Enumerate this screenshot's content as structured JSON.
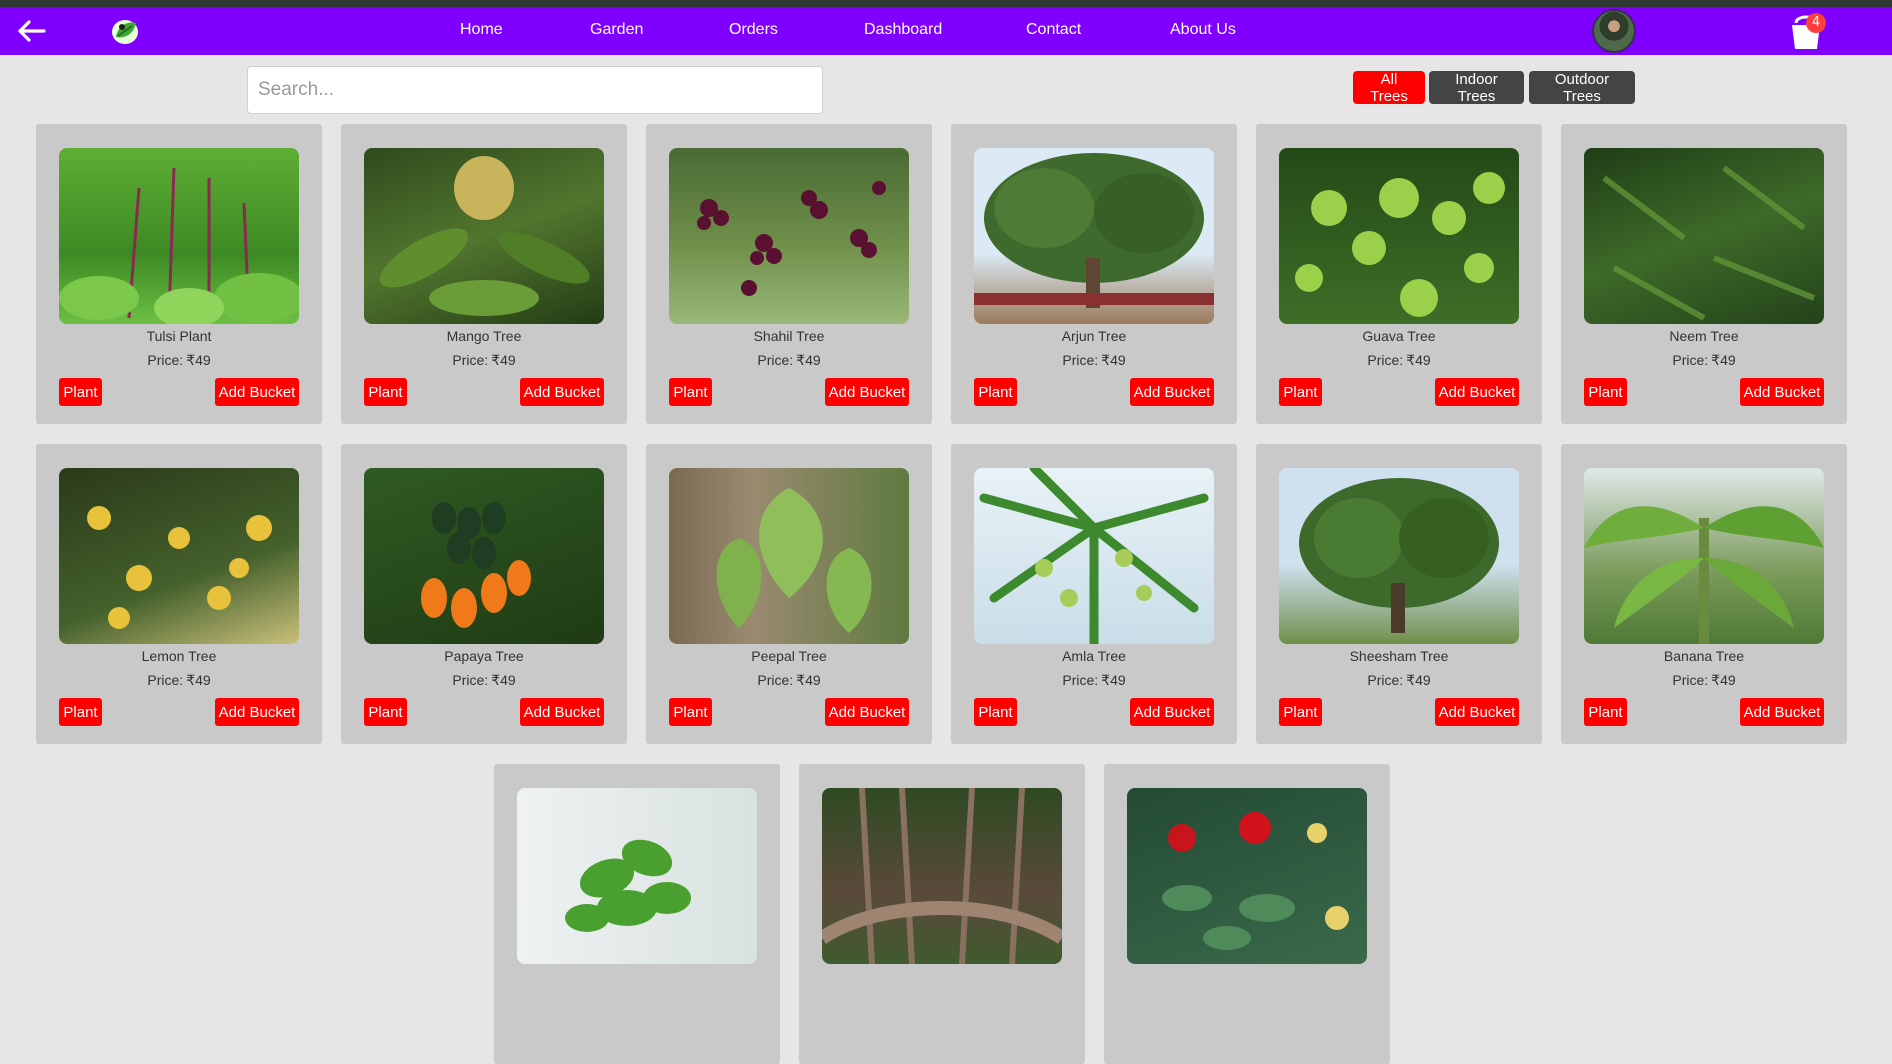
{
  "nav": {
    "links": [
      {
        "id": "home",
        "label": "Home"
      },
      {
        "id": "garden",
        "label": "Garden"
      },
      {
        "id": "orders",
        "label": "Orders"
      },
      {
        "id": "dashboard",
        "label": "Dashboard"
      },
      {
        "id": "contact",
        "label": "Contact"
      },
      {
        "id": "about",
        "label": "About Us"
      }
    ],
    "cart_count": "4",
    "icons": {
      "back": "arrow-left-icon",
      "logo": "leaf-logo-icon",
      "cart": "bucket-icon"
    }
  },
  "search": {
    "placeholder": "Search...",
    "value": ""
  },
  "filters": [
    {
      "id": "all",
      "label": "All Trees",
      "active": true
    },
    {
      "id": "indoor",
      "label": "Indoor Trees",
      "active": false
    },
    {
      "id": "outdoor",
      "label": "Outdoor Trees",
      "active": false
    }
  ],
  "products": [
    {
      "name": "Tulsi Plant",
      "price": "₹49"
    },
    {
      "name": "Mango Tree",
      "price": "₹49"
    },
    {
      "name": "Shahil Tree",
      "price": "₹49"
    },
    {
      "name": "Arjun Tree",
      "price": "₹49"
    },
    {
      "name": "Guava Tree",
      "price": "₹49"
    },
    {
      "name": "Neem Tree",
      "price": "₹49"
    },
    {
      "name": "Lemon Tree",
      "price": "₹49"
    },
    {
      "name": "Papaya Tree",
      "price": "₹49"
    },
    {
      "name": "Peepal Tree",
      "price": "₹49"
    },
    {
      "name": "Amla Tree",
      "price": "₹49"
    },
    {
      "name": "Sheesham Tree",
      "price": "₹49"
    },
    {
      "name": "Banana Tree",
      "price": "₹49"
    },
    {
      "name": "",
      "price": ""
    },
    {
      "name": "",
      "price": ""
    },
    {
      "name": "",
      "price": ""
    }
  ],
  "labels": {
    "price_prefix": "Price:",
    "plant_button": "Plant",
    "bucket_button": "Add Bucket"
  },
  "colors": {
    "nav_bg": "#8000ff",
    "accent": "#ff0000",
    "card_bg": "#c9c9c9"
  }
}
